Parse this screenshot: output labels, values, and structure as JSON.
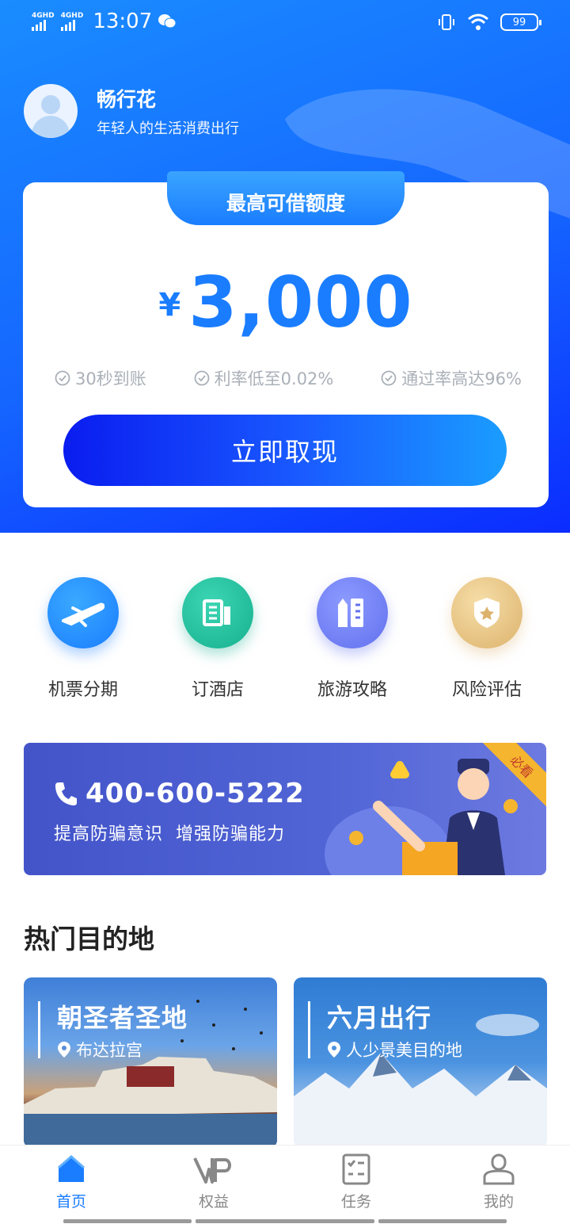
{
  "status_bar": {
    "signal1_label": "4GHD",
    "signal2_label": "4GHD",
    "time": "13:07",
    "battery": "99"
  },
  "profile": {
    "name": "畅行花",
    "subtitle": "年轻人的生活消费出行"
  },
  "loan_card": {
    "tab_title": "最高可借额度",
    "currency": "¥",
    "amount": "3,000",
    "features": [
      "30秒到账",
      "利率低至0.02%",
      "通过率高达96%"
    ],
    "cta_label": "立即取现"
  },
  "services": [
    {
      "label": "机票分期",
      "icon": "airplane-icon",
      "color": "#1a8cff"
    },
    {
      "label": "订酒店",
      "icon": "hotel-icon",
      "color": "#1fbf9f"
    },
    {
      "label": "旅游攻略",
      "icon": "guide-icon",
      "color": "#6f7ff5"
    },
    {
      "label": "风险评估",
      "icon": "shield-icon",
      "color": "#e5c07b"
    }
  ],
  "banner": {
    "phone": "400-600-5222",
    "slogan": "提高防骗意识  增强防骗能力",
    "ribbon": "必看"
  },
  "section_title": "热门目的地",
  "destinations": [
    {
      "title": "朝圣者圣地",
      "subtitle": "布达拉宫"
    },
    {
      "title": "六月出行",
      "subtitle": "人少景美目的地"
    }
  ],
  "tabbar": [
    {
      "label": "首页",
      "icon": "home-icon",
      "active": true
    },
    {
      "label": "权益",
      "icon": "vip-icon",
      "active": false
    },
    {
      "label": "任务",
      "icon": "task-icon",
      "active": false
    },
    {
      "label": "我的",
      "icon": "user-icon",
      "active": false
    }
  ],
  "colors": {
    "accent": "#1a7dff",
    "hero_gradient_start": "#1a8cff",
    "hero_gradient_end": "#0b2cff",
    "banner_bg": "#4a5cd0"
  }
}
